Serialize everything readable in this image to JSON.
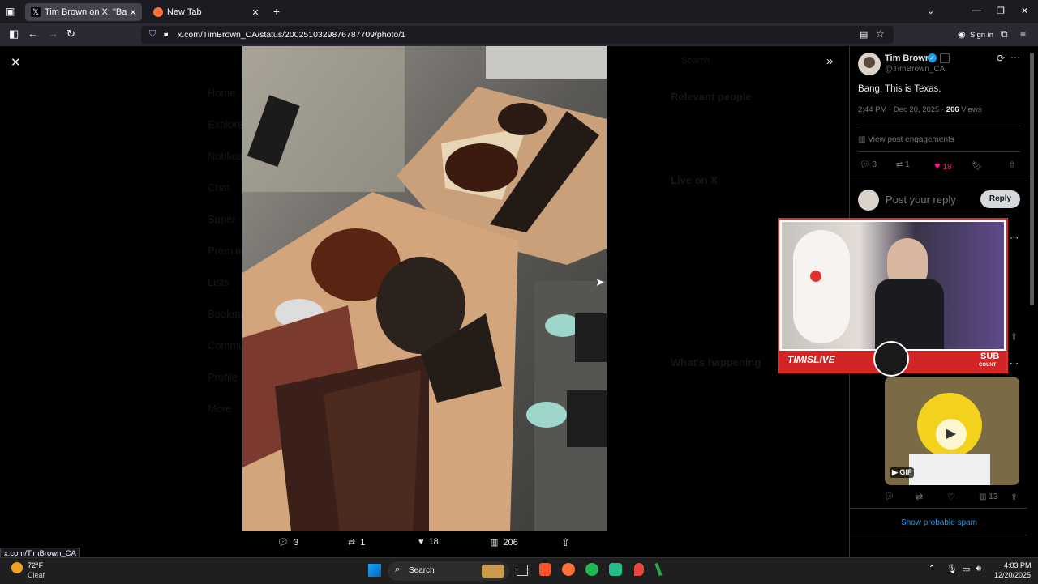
{
  "browser": {
    "tabs": [
      {
        "label": "Tim Brown on X: \"Bang. This is T",
        "active": true
      },
      {
        "label": "New Tab",
        "active": false
      }
    ],
    "url": "x.com/TimBrown_CA/status/2002510329876787709/photo/1",
    "sign_in": "Sign in",
    "status_url": "x.com/TimBrown_CA"
  },
  "background": {
    "nav": [
      "Home",
      "Explore",
      "Notifications",
      "Chat",
      "Super",
      "Premium",
      "Lists",
      "Bookmarks",
      "Communities",
      "Profile",
      "More"
    ],
    "search": "Search",
    "relevant_people": "Relevant people",
    "live_on_x": "Live on X",
    "whats_happening": "What's happening"
  },
  "photo_actions": {
    "replies": "3",
    "reposts": "1",
    "likes": "18",
    "views": "206"
  },
  "post": {
    "name": "Tim Brown",
    "handle": "@TimBrown_CA",
    "text": "Bang. This is Texas.",
    "time": "2:44 PM · Dec 20, 2025 · ",
    "views_count": "206",
    "views_label": " Views",
    "engagements": "View post engagements",
    "replies": "3",
    "reposts": "1",
    "likes": "18",
    "reply_placeholder": "Post your reply",
    "reply_button": "Reply"
  },
  "overlay": {
    "brand": "TIMISLIVE",
    "sub_label_1": "SUB",
    "sub_label_2": "COUNT"
  },
  "gif_post": {
    "badge": "GIF",
    "views": "13",
    "show_spam": "Show probable spam"
  },
  "taskbar": {
    "temp": "72°F",
    "weather": "Clear",
    "search": "Search",
    "time": "4:03 PM",
    "date": "12/20/2025"
  },
  "colors": {
    "like": "#f91880",
    "link": "#1d9bf0",
    "verified": "#1d9bf0"
  }
}
